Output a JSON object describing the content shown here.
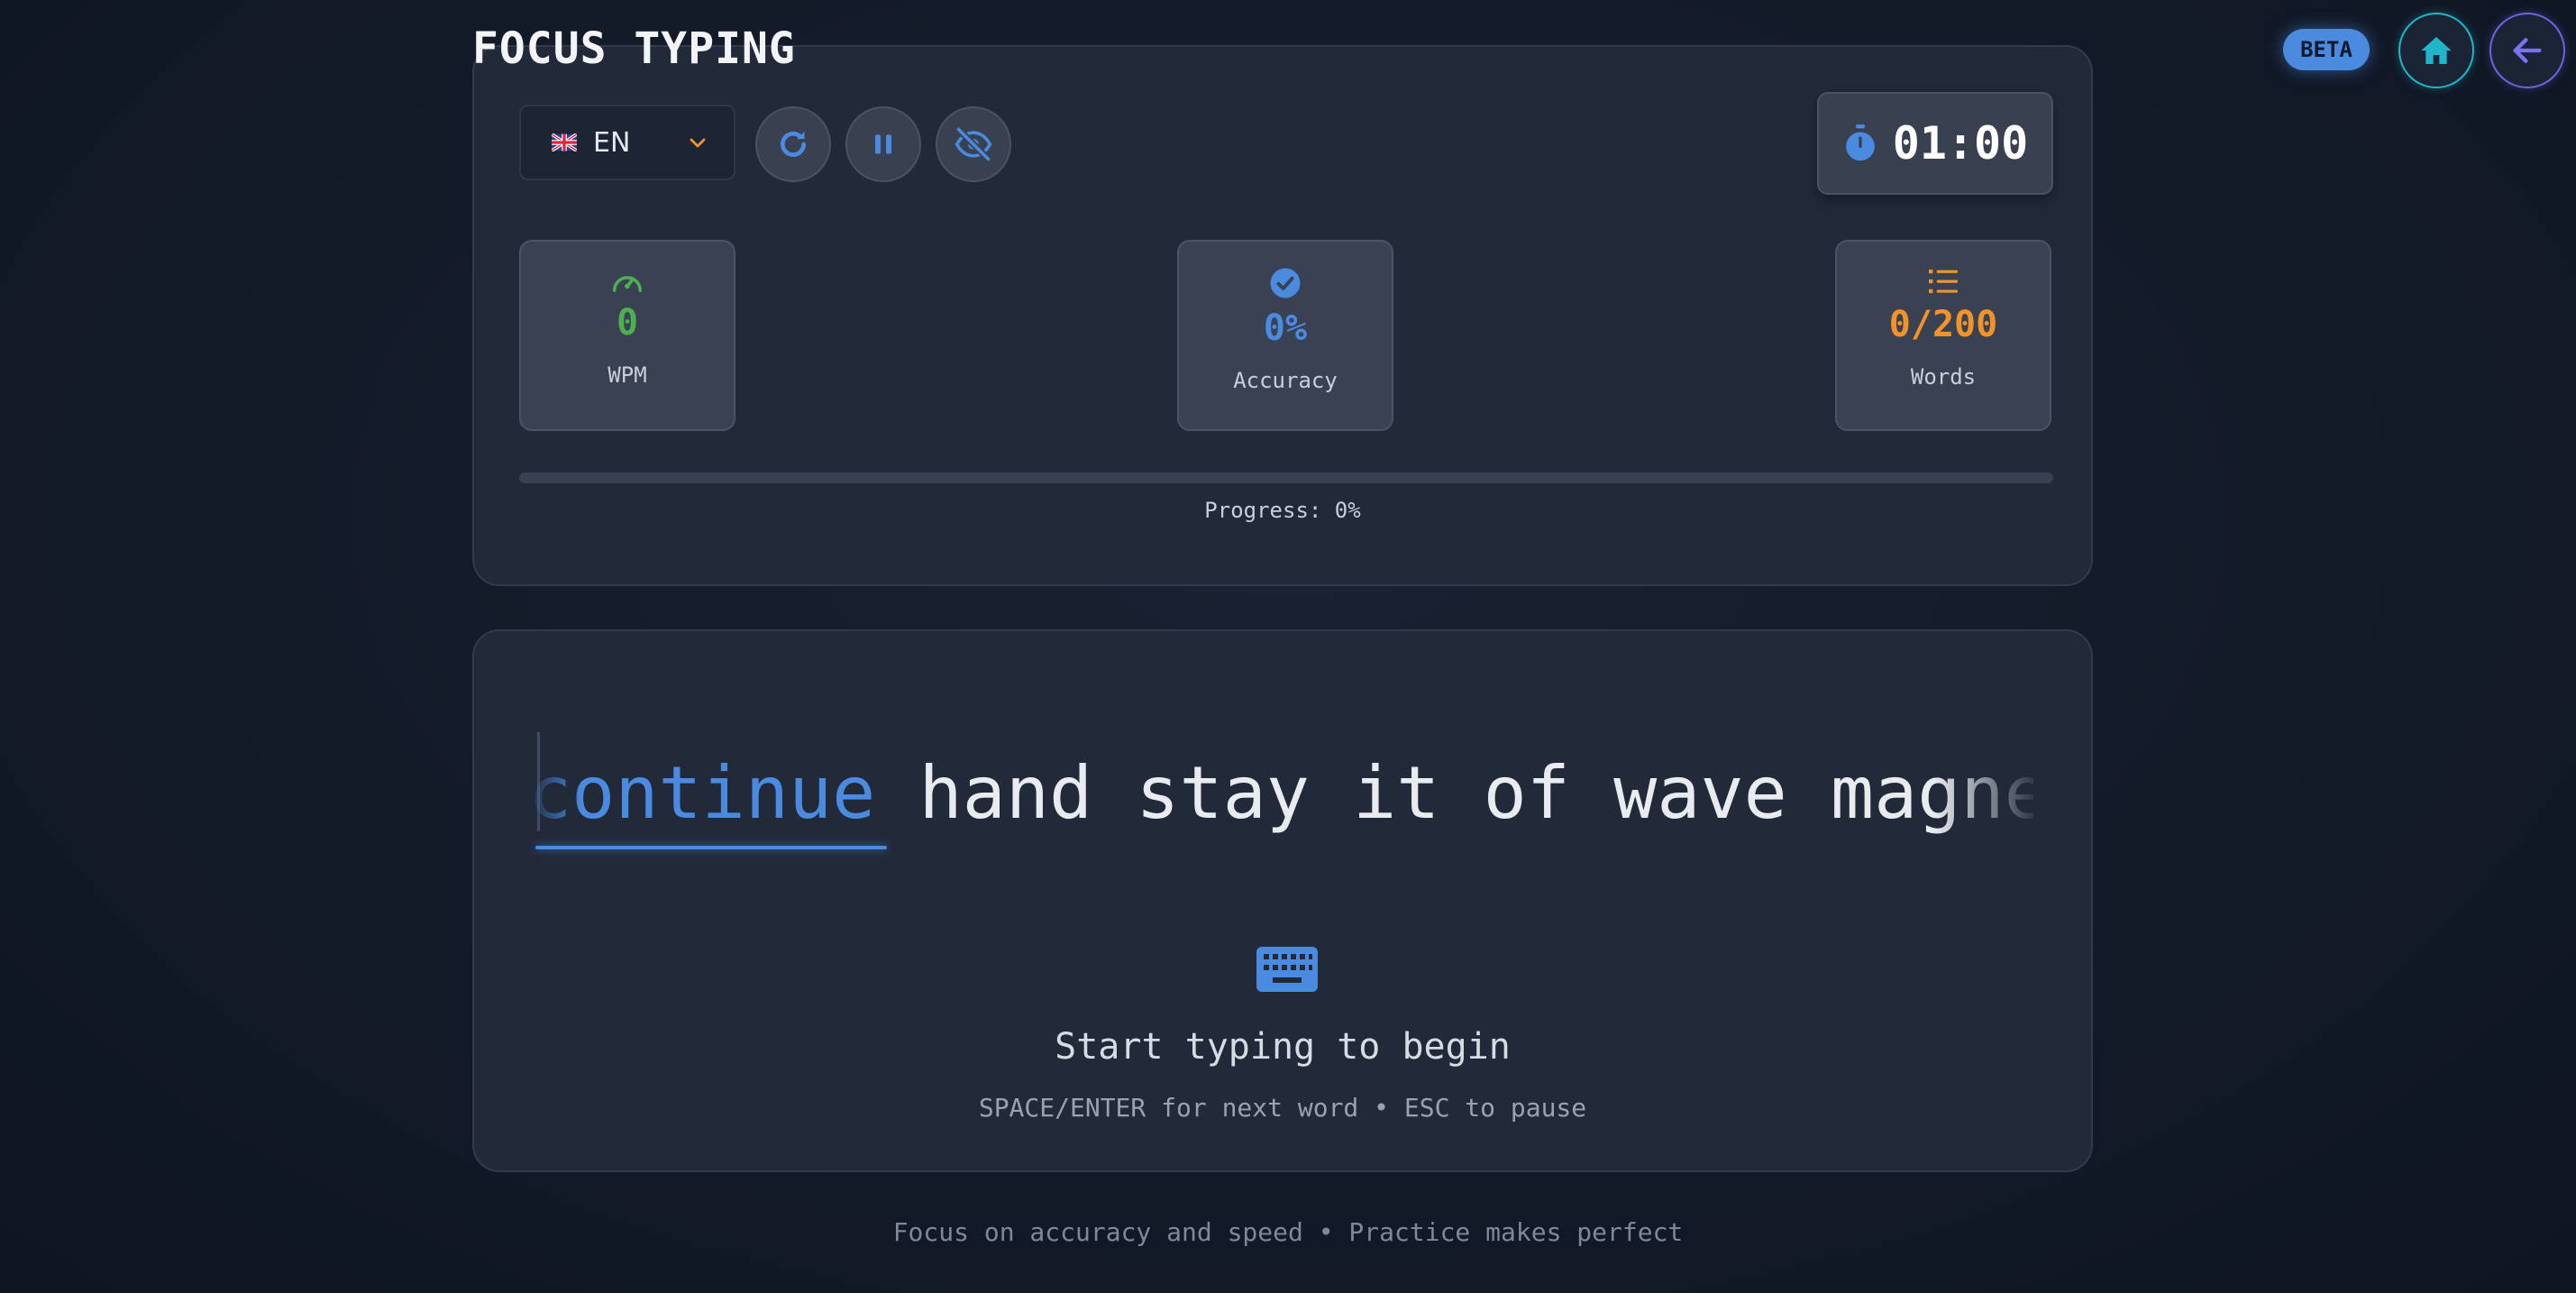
{
  "app": {
    "title": "FOCUS TYPING",
    "badge": "BETA"
  },
  "nav": {
    "home_icon": "home-icon",
    "back_icon": "arrow-left-icon"
  },
  "controls": {
    "language": {
      "flag_icon": "uk-flag-icon",
      "selected": "EN"
    },
    "restart_icon": "restart-icon",
    "pause_icon": "pause-icon",
    "hide_icon": "eye-slash-icon",
    "timer": {
      "icon": "stopwatch-icon",
      "value": "01:00"
    }
  },
  "stats": {
    "wpm": {
      "icon": "speedometer-icon",
      "value": "0",
      "label": "WPM",
      "color": "#4caf50"
    },
    "accuracy": {
      "icon": "check-circle-icon",
      "value": "0%",
      "label": "Accuracy",
      "color": "#4a8bdf"
    },
    "words": {
      "icon": "list-icon",
      "value": "0/200",
      "label": "Words",
      "color": "#f0932b"
    }
  },
  "progress": {
    "percent": 0,
    "label": "Progress: 0%"
  },
  "typing": {
    "current_word": "continue",
    "upcoming": "hand stay it of wave magnet",
    "prompt": "Start typing to begin",
    "hint": "SPACE/ENTER for next word • ESC to pause"
  },
  "footer": {
    "text": "Focus on accuracy and speed • Practice makes perfect"
  },
  "colors": {
    "accent": "#4a8bdf",
    "background": "#131a28",
    "panel": "#222939"
  }
}
